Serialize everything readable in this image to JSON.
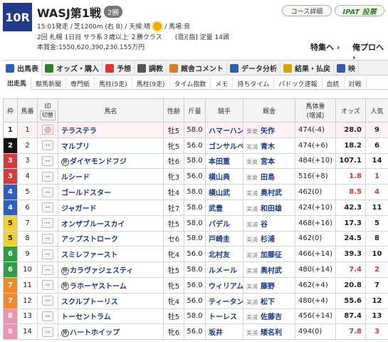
{
  "race": {
    "number": "10R",
    "name": "WASJ第1戦",
    "grade": "2勝",
    "info_line1_a": "15:01発走 /",
    "info_line1_b": "芝1200m (右 B) / 天候:晴",
    "info_line1_c": "/ 馬場:良",
    "info_line2": "2回 札幌 1日目 サラ系３歳以上 ２勝クラス　　(混)[指] 定量 14頭",
    "info_line3": "本賞金:1550,620,390,230,155万円"
  },
  "header_buttons": {
    "course": "コース詳細",
    "ipat": "IPAT 投票"
  },
  "links": {
    "feature": "特集へ",
    "pro": "俺プロへ"
  },
  "tabs": [
    {
      "label": "出馬表",
      "icon": "table-icon",
      "color": "#2e5fb5"
    },
    {
      "label": "オッズ・購入",
      "icon": "ticket-icon",
      "color": "#2e7d32"
    },
    {
      "label": "予想",
      "icon": "target-icon",
      "color": "#d33"
    },
    {
      "label": "調教",
      "icon": "stopwatch-icon",
      "color": "#555"
    },
    {
      "label": "厩舎コメント",
      "icon": "comment-icon",
      "color": "#e07a1f"
    },
    {
      "label": "データ分析",
      "icon": "chart-icon",
      "color": "#2e5fb5"
    },
    {
      "label": "結果・払戻",
      "icon": "coins-icon",
      "color": "#d9a400"
    },
    {
      "label": "映",
      "icon": "video-icon",
      "color": "#2e5fb5"
    }
  ],
  "subtabs": [
    "出走馬",
    "競馬新聞",
    "専門紙",
    "馬柱(5走)",
    "馬柱(9走)",
    "タイム指数",
    "メモ",
    "持ちタイム",
    "パドック速報",
    "血統",
    "対戦"
  ],
  "table": {
    "headers": {
      "waku": "枠",
      "umaban": "馬番",
      "mark": "印",
      "mark_sub": "切替",
      "horse": "馬名",
      "sex": "性齢",
      "weight": "斤量",
      "jockey": "騎手",
      "trainer": "厩舎",
      "body": "馬体重",
      "body_sub": "(増減)",
      "odds": "オッズ",
      "pop": "人気"
    },
    "rows": [
      {
        "waku": "1",
        "num": "1",
        "mark": "◎",
        "prefix": "",
        "horse": "テラステラ",
        "sex": "牡5",
        "weight": "58.0",
        "jockey": "ハマーハン",
        "region": "栗東",
        "trainer": "矢作",
        "body": "474(-4)",
        "odds": "28.0",
        "pop": "9",
        "red": false
      },
      {
        "waku": "2",
        "num": "2",
        "mark": "--",
        "prefix": "",
        "horse": "マルブリ",
        "sex": "牝5",
        "weight": "56.0",
        "jockey": "ゴンサルベ",
        "region": "美浦",
        "trainer": "青木",
        "body": "474(+6)",
        "odds": "18.2",
        "pop": "6",
        "red": false
      },
      {
        "waku": "3",
        "num": "3",
        "mark": "--",
        "prefix": "外",
        "horse": "ダイヤモンドフジ",
        "sex": "牡6",
        "weight": "58.0",
        "jockey": "本田重",
        "region": "栗東",
        "trainer": "宮本",
        "body": "484(+10)",
        "odds": "107.1",
        "pop": "14",
        "red": false
      },
      {
        "waku": "3",
        "num": "4",
        "mark": "--",
        "prefix": "",
        "horse": "ルシード",
        "sex": "牝3",
        "weight": "56.0",
        "jockey": "横山典",
        "region": "栗東",
        "trainer": "田島",
        "body": "516(+8)",
        "odds": "1.8",
        "pop": "1",
        "red": true
      },
      {
        "waku": "4",
        "num": "5",
        "mark": "--",
        "prefix": "",
        "horse": "ゴールドスター",
        "sex": "牡4",
        "weight": "58.0",
        "jockey": "横山武",
        "region": "美浦",
        "trainer": "奥村武",
        "body": "462(0)",
        "odds": "8.5",
        "pop": "4",
        "red": true
      },
      {
        "waku": "4",
        "num": "6",
        "mark": "--",
        "prefix": "",
        "horse": "ジャガード",
        "sex": "牡7",
        "weight": "58.0",
        "jockey": "武豊",
        "region": "美浦",
        "trainer": "和田雄",
        "body": "424(+10)",
        "odds": "42.3",
        "pop": "11",
        "red": false
      },
      {
        "waku": "5",
        "num": "7",
        "mark": "--",
        "prefix": "",
        "horse": "オンザブルースカイ",
        "sex": "牡5",
        "weight": "58.0",
        "jockey": "バデル",
        "region": "美浦",
        "trainer": "谷",
        "body": "468(+16)",
        "odds": "17.3",
        "pop": "5",
        "red": false
      },
      {
        "waku": "5",
        "num": "8",
        "mark": "--",
        "prefix": "",
        "horse": "アップストローク",
        "sex": "セ6",
        "weight": "58.0",
        "jockey": "戸崎圭",
        "region": "美浦",
        "trainer": "杉浦",
        "body": "462(0)",
        "odds": "24.5",
        "pop": "8",
        "red": false
      },
      {
        "waku": "6",
        "num": "9",
        "mark": "--",
        "prefix": "",
        "horse": "スミレファースト",
        "sex": "牝4",
        "weight": "56.0",
        "jockey": "北村友",
        "region": "美浦",
        "trainer": "加藤征",
        "body": "466(+14)",
        "odds": "39.3",
        "pop": "10",
        "red": false
      },
      {
        "waku": "6",
        "num": "10",
        "mark": "--",
        "prefix": "外",
        "horse": "カラヴァジェスティ",
        "sex": "牡5",
        "weight": "58.0",
        "jockey": "ルメール",
        "region": "美浦",
        "trainer": "奥村武",
        "body": "480(+14)",
        "odds": "7.4",
        "pop": "2",
        "red": true
      },
      {
        "waku": "7",
        "num": "11",
        "mark": "--",
        "prefix": "外",
        "horse": "ラホーヤストーム",
        "sex": "牝5",
        "weight": "56.0",
        "jockey": "ウィリアム",
        "region": "美浦",
        "trainer": "藤野",
        "body": "462(+4)",
        "odds": "20.8",
        "pop": "7",
        "red": false
      },
      {
        "waku": "7",
        "num": "12",
        "mark": "--",
        "prefix": "",
        "horse": "スクルプトーリス",
        "sex": "牝4",
        "weight": "56.0",
        "jockey": "ティータン",
        "region": "美浦",
        "trainer": "松下",
        "body": "480(+4)",
        "odds": "55.6",
        "pop": "12",
        "red": false
      },
      {
        "waku": "8",
        "num": "13",
        "mark": "--",
        "prefix": "",
        "horse": "トーセントラム",
        "sex": "牡5",
        "weight": "58.0",
        "jockey": "トーレス",
        "region": "美浦",
        "trainer": "佐藤吉",
        "body": "456(+14)",
        "odds": "87.4",
        "pop": "13",
        "red": false
      },
      {
        "waku": "8",
        "num": "14",
        "mark": "--",
        "prefix": "外",
        "horse": "ハートホイップ",
        "sex": "牝6",
        "weight": "56.0",
        "jockey": "坂井",
        "region": "美浦",
        "trainer": "矮名利",
        "body": "494(0)",
        "odds": "7.8",
        "pop": "3",
        "red": true
      }
    ]
  },
  "colors": {
    "waku_1": "#ffffff",
    "waku_2": "#111111",
    "waku_3": "#d83a3a",
    "waku_4": "#2b5fc4",
    "waku_5": "#f3cf2a",
    "waku_6": "#2f9e44",
    "waku_7": "#f08a24",
    "waku_8": "#f092b0",
    "accent": "#223a8c"
  }
}
